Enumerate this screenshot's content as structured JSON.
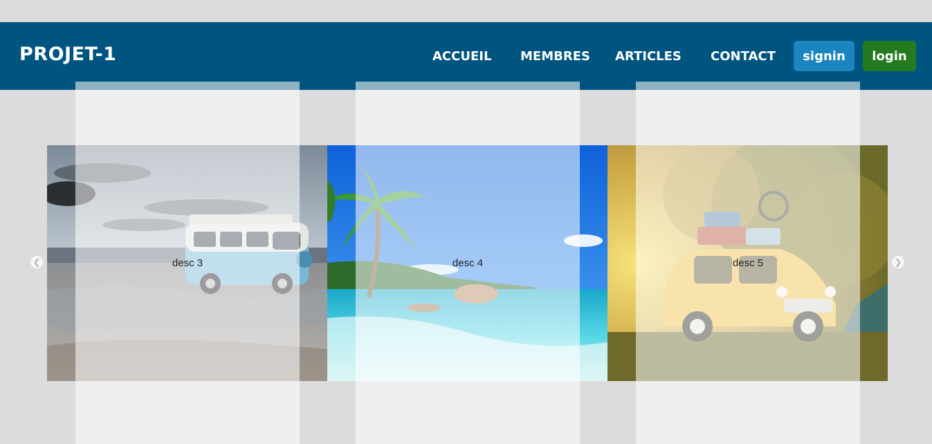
{
  "header": {
    "brand": "PROJET-1",
    "nav": [
      "ACCUEIL",
      "MEMBRES",
      "ARTICLES",
      "CONTACT"
    ],
    "signin_label": "signin",
    "login_label": "login"
  },
  "carousel": {
    "slides": [
      {
        "caption": "desc 3",
        "image": "vintage-van-on-beach"
      },
      {
        "caption": "desc 4",
        "image": "tropical-beach-palm"
      },
      {
        "caption": "desc 5",
        "image": "yellow-car-with-luggage"
      }
    ],
    "prev_icon": "chevron-left-icon",
    "next_icon": "chevron-right-icon"
  },
  "colors": {
    "header_bg": "#005580",
    "signin_bg": "#1a85bf",
    "login_bg": "#237a1f",
    "page_bg": "#dcdcdc"
  }
}
